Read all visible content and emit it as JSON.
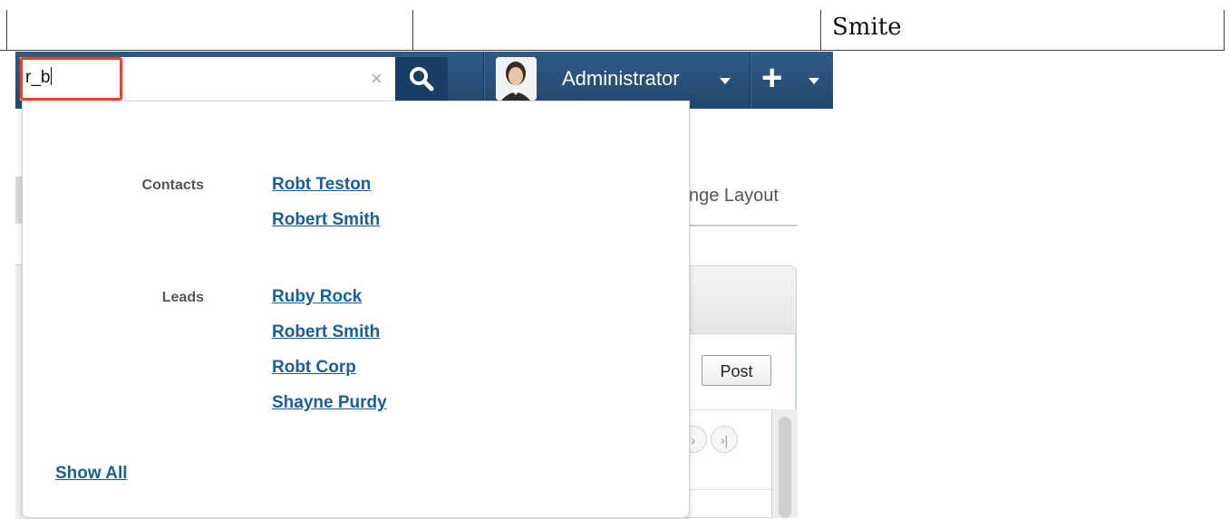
{
  "table_strip": {
    "cell_text": "Smite"
  },
  "search": {
    "value": "r_b",
    "clear_label": "×"
  },
  "user": {
    "name": "Administrator"
  },
  "quick_create": {
    "label": "+"
  },
  "background": {
    "change_layout": "nge Layout",
    "post_button": "Post",
    "pager_next": "›",
    "pager_last": "›|"
  },
  "dropdown": {
    "groups": [
      {
        "label": "Contacts",
        "results": [
          "Robt Teston",
          "Robert Smith"
        ]
      },
      {
        "label": "Leads",
        "results": [
          "Ruby Rock",
          "Robert Smith",
          "Robt Corp",
          "Shayne Purdy"
        ]
      }
    ],
    "show_all": "Show All"
  },
  "colors": {
    "navbar": "#23476c",
    "search_button": "#173e63",
    "highlight": "#e8422c",
    "link": "#1a5f99"
  }
}
